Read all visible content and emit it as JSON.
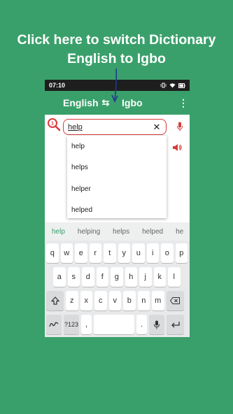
{
  "promo": {
    "line1": "Click here to switch Dictionary",
    "line2": "English to Igbo"
  },
  "status_bar": {
    "time": "07:10"
  },
  "app_bar": {
    "source_language": "English",
    "swap_icon": "swap-icon",
    "target_language": "Igbo",
    "menu_icon": "more-vert-icon"
  },
  "search": {
    "step_number": "1",
    "value": "help",
    "clear_icon": "close-icon",
    "voice_icon": "mic-icon"
  },
  "pronounce_icon": "speaker-icon",
  "suggestions_dropdown": [
    "help",
    "helps",
    "helper",
    "helped"
  ],
  "keyboard": {
    "suggestion_strip": [
      "help",
      "helping",
      "helps",
      "helped",
      "he"
    ],
    "row1": [
      "q",
      "w",
      "e",
      "r",
      "t",
      "y",
      "u",
      "i",
      "o",
      "p"
    ],
    "row2": [
      "a",
      "s",
      "d",
      "f",
      "g",
      "h",
      "j",
      "k",
      "l"
    ],
    "row3": [
      "z",
      "x",
      "c",
      "v",
      "b",
      "n",
      "m"
    ],
    "symbols_label": "?123",
    "comma": ",",
    "period": "."
  },
  "colors": {
    "brand_green": "#3aa06b",
    "accent_red": "#d93b3b",
    "arrow_blue": "#1f3a8f"
  }
}
